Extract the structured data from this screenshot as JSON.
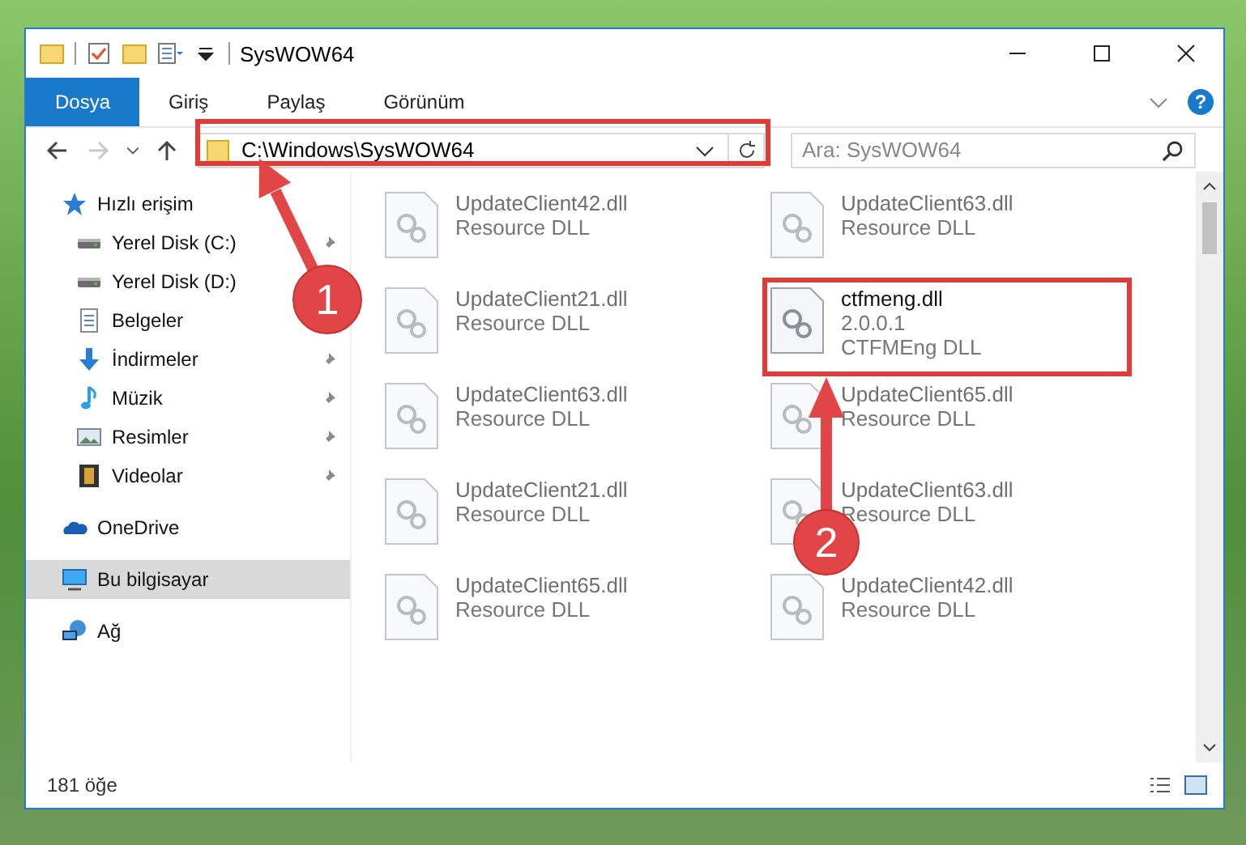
{
  "window": {
    "title": "SysWOW64"
  },
  "ribbon": {
    "tabs": [
      {
        "label": "Dosya",
        "selected": true
      },
      {
        "label": "Giriş",
        "selected": false
      },
      {
        "label": "Paylaş",
        "selected": false
      },
      {
        "label": "Görünüm",
        "selected": false
      }
    ],
    "help": "?"
  },
  "navigation": {
    "forward": {
      "disabled": true
    }
  },
  "address": {
    "path": "C:\\Windows\\SysWOW64"
  },
  "search": {
    "placeholder": "Ara: SysWOW64"
  },
  "sidebar": {
    "items": [
      {
        "label": "Hızlı erişim",
        "kind": "star",
        "pinned": false,
        "selected": false,
        "children": [
          {
            "label": "Yerel Disk (C:)",
            "kind": "drive",
            "pinned": true,
            "selected": false
          },
          {
            "label": "Yerel Disk (D:)",
            "kind": "drive",
            "selected": false
          },
          {
            "label": "Belgeler",
            "kind": "document",
            "selected": false
          },
          {
            "label": "İndirmeler",
            "kind": "download",
            "pinned": true,
            "selected": false
          },
          {
            "label": "Müzik",
            "kind": "music",
            "pinned": true,
            "selected": false
          },
          {
            "label": "Resimler",
            "kind": "picture",
            "pinned": true,
            "selected": false
          },
          {
            "label": "Videolar",
            "kind": "video",
            "pinned": true,
            "selected": false
          }
        ]
      },
      {
        "label": "OneDrive",
        "kind": "cloud",
        "pinned": false,
        "selected": false
      },
      {
        "label": "Bu bilgisayar",
        "kind": "computer",
        "pinned": false,
        "selected": true
      },
      {
        "label": "Ağ",
        "kind": "network",
        "pinned": false,
        "selected": false
      }
    ]
  },
  "files": [
    {
      "name": "UpdateClient42.dll",
      "lines": [
        "Resource DLL"
      ],
      "blurred": true
    },
    {
      "name": "UpdateClient63.dll",
      "lines": [
        "Resource DLL"
      ],
      "blurred": true
    },
    {
      "name": "UpdateClient21.dll",
      "lines": [
        "Resource DLL"
      ],
      "blurred": true
    },
    {
      "name": "ctfmeng.dll",
      "lines": [
        "2.0.0.1",
        "CTFMEng DLL"
      ],
      "blurred": false
    },
    {
      "name": "UpdateClient63.dll",
      "lines": [
        "Resource DLL"
      ],
      "blurred": true
    },
    {
      "name": "UpdateClient65.dll",
      "lines": [
        "Resource DLL"
      ],
      "blurred": true
    },
    {
      "name": "UpdateClient21.dll",
      "lines": [
        "Resource DLL"
      ],
      "blurred": true
    },
    {
      "name": "UpdateClient63.dll",
      "lines": [
        "Resource DLL"
      ],
      "blurred": true
    },
    {
      "name": "UpdateClient65.dll",
      "lines": [
        "Resource DLL"
      ],
      "blurred": true
    },
    {
      "name": "UpdateClient42.dll",
      "lines": [
        "Resource DLL"
      ],
      "blurred": true
    }
  ],
  "status_bar": {
    "count": "181 öğe"
  },
  "annotations": [
    {
      "number": "1"
    },
    {
      "number": "2"
    }
  ]
}
